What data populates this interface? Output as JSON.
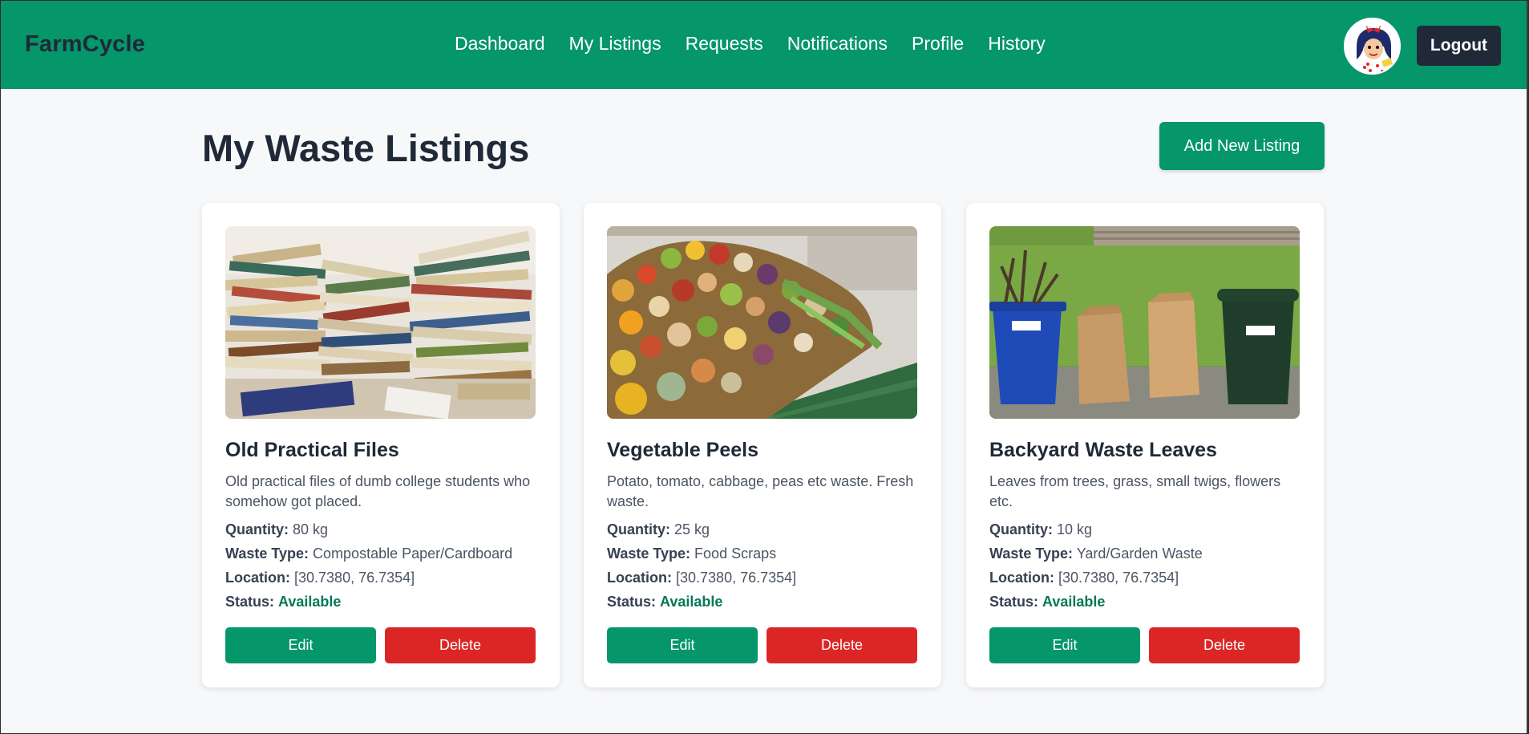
{
  "navbar": {
    "brand": "FarmCycle",
    "links": [
      "Dashboard",
      "My Listings",
      "Requests",
      "Notifications",
      "Profile",
      "History"
    ],
    "logout_label": "Logout",
    "color": "#05966a"
  },
  "header": {
    "title": "My Waste Listings",
    "add_button_label": "Add New Listing"
  },
  "labels": {
    "quantity": "Quantity:",
    "waste_type": "Waste Type:",
    "location": "Location:",
    "status": "Status:",
    "edit": "Edit",
    "delete": "Delete"
  },
  "listings": [
    {
      "title": "Old Practical Files",
      "description": "Old practical files of dumb college students who somehow got placed.",
      "quantity": "80 kg",
      "waste_type": "Compostable Paper/Cardboard",
      "location": "[30.7380, 76.7354]",
      "status": "Available",
      "image_icon": "stacked-books-image"
    },
    {
      "title": "Vegetable Peels",
      "description": "Potato, tomato, cabbage, peas etc waste. Fresh waste.",
      "quantity": "25 kg",
      "waste_type": "Food Scraps",
      "location": "[30.7380, 76.7354]",
      "status": "Available",
      "image_icon": "vegetable-pile-image"
    },
    {
      "title": "Backyard Waste Leaves",
      "description": "Leaves from trees, grass, small twigs, flowers etc.",
      "quantity": "10 kg",
      "waste_type": "Yard/Garden Waste",
      "location": "[30.7380, 76.7354]",
      "status": "Available",
      "image_icon": "yard-waste-bins-image"
    }
  ],
  "colors": {
    "primary": "#05966a",
    "danger": "#dc2626",
    "status_available": "#047857",
    "dark": "#1f2937"
  }
}
